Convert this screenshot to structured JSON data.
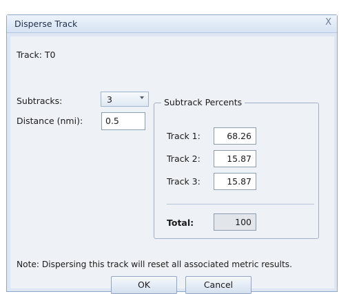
{
  "dialog": {
    "title": "Disperse Track",
    "close_glyph": "X",
    "track_label": "Track: T0",
    "subtracks_label": "Subtracks:",
    "subtracks_value": "3",
    "distance_label": "Distance (nmi):",
    "distance_value": "0.5",
    "group_title": "Subtrack Percents",
    "rows": [
      {
        "label": "Track 1:",
        "value": "68.26"
      },
      {
        "label": "Track 2:",
        "value": "15.87"
      },
      {
        "label": "Track 3:",
        "value": "15.87"
      }
    ],
    "total_label": "Total:",
    "total_value": "100",
    "note": "Note: Dispersing this track will reset all associated metric results.",
    "ok_label": "OK",
    "cancel_label": "Cancel"
  }
}
